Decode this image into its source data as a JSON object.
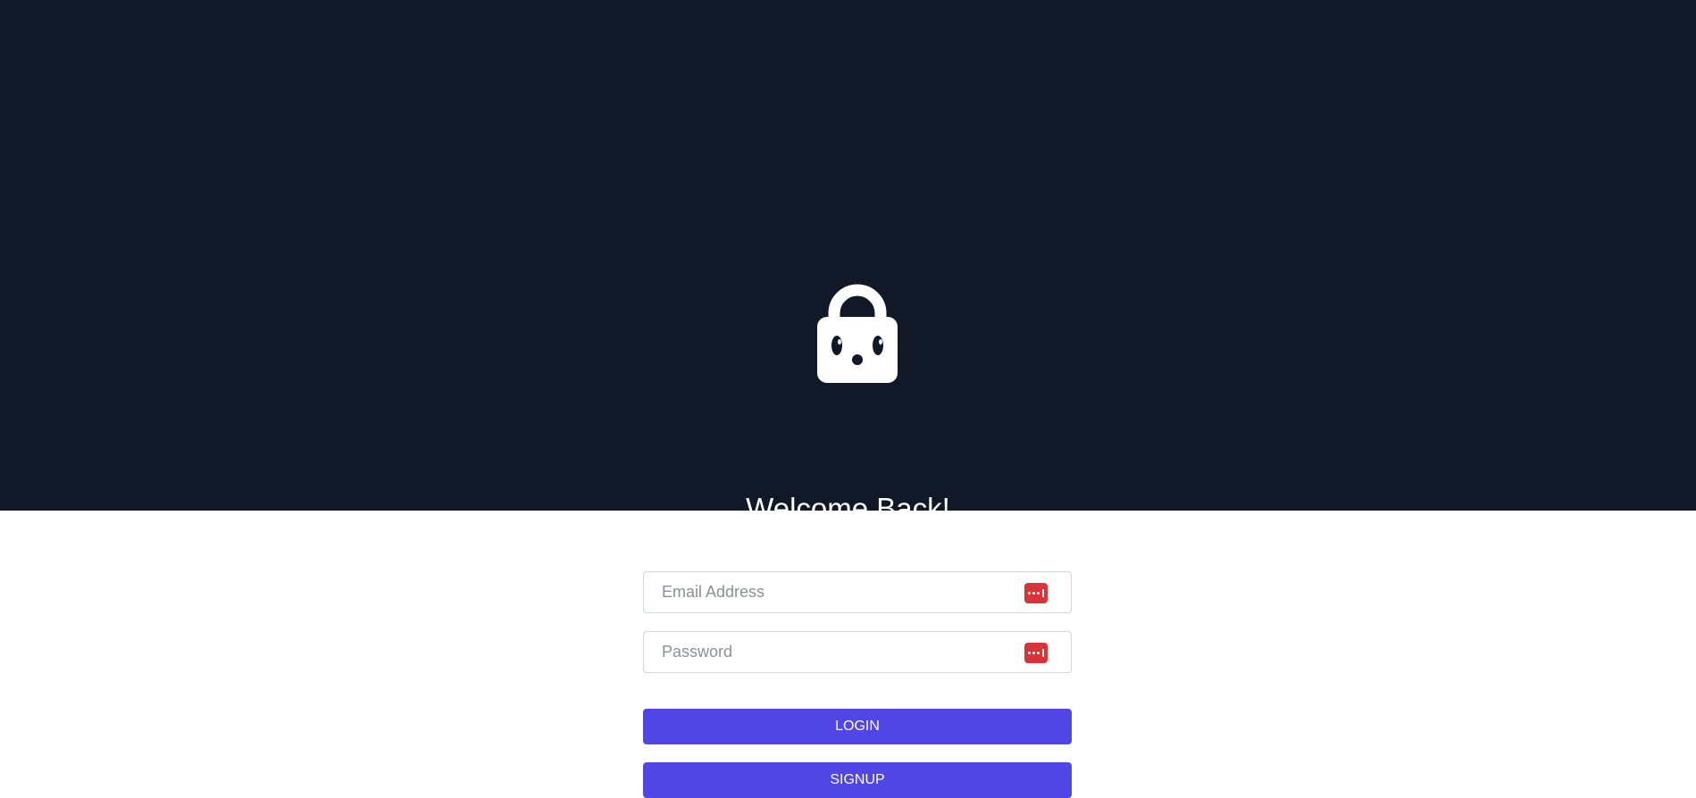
{
  "hero": {
    "background_color": "#111827",
    "logo_icon": "lock-face-icon",
    "title": "Welcome Back!"
  },
  "form": {
    "email": {
      "placeholder": "Email Address",
      "value": "",
      "autofill_icon": "password-manager-icon"
    },
    "password": {
      "placeholder": "Password",
      "value": "",
      "autofill_icon": "password-manager-icon"
    },
    "login_label": "LOGIN",
    "signup_label": "SIGNUP",
    "button_color": "#4f46e5",
    "autofill_icon_color": "#d9343a"
  }
}
